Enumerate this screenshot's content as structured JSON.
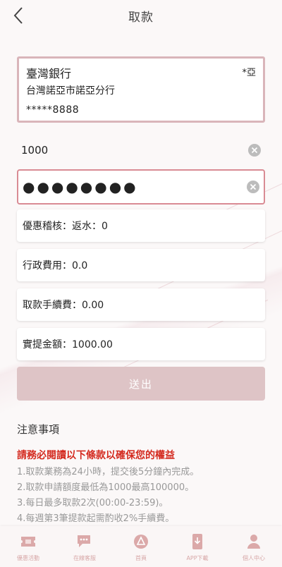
{
  "header": {
    "title": "取款"
  },
  "bank_card": {
    "bank_name": "臺灣銀行",
    "branch": "台灣諾亞市諾亞分行",
    "account_masked": "*****8888",
    "holder_tag": "*亞"
  },
  "form": {
    "amount_value": "1000",
    "password_value": "●●●●●●●●"
  },
  "summary": {
    "bonus_audit": "優惠稽核：返水：0",
    "admin_fee": "行政費用：0.0",
    "withdraw_fee": "取款手續費：0.00",
    "actual_amount": "實提金額：1000.00"
  },
  "submit_label": "送出",
  "notes": {
    "heading": "注意事項",
    "warning": "請務必閱讀以下條款以確保您的權益",
    "items": [
      "1.取款業務為24小時，提交後5分鐘內完成。",
      "2.取款申請額度最低為1000最高100000。",
      "3.每日最多取款2次(00:00-23:59)。",
      "4.每週第3筆提款起需酌收2%手續費。"
    ]
  },
  "tabbar": {
    "items": [
      {
        "label": "優惠活動",
        "icon": "ticket-icon"
      },
      {
        "label": "在線客服",
        "icon": "chat-icon"
      },
      {
        "label": "首頁",
        "icon": "home-logo-icon"
      },
      {
        "label": "APP下載",
        "icon": "phone-download-icon"
      },
      {
        "label": "個人中心",
        "icon": "user-icon"
      }
    ]
  },
  "colors": {
    "accent_border": "#d98b94",
    "card_border": "#d9b5ba",
    "submit_disabled": "#dec4c6",
    "warning_red": "#d42a1f",
    "tab_icon": "#d7a7a7"
  }
}
